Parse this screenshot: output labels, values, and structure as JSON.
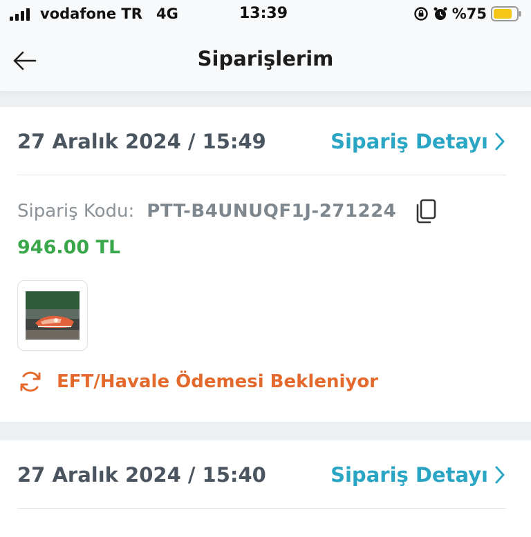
{
  "status_bar": {
    "carrier": "vodafone TR",
    "network": "4G",
    "time": "13:39",
    "battery": "%75",
    "battery_color": "#f5c518"
  },
  "header": {
    "title": "Siparişlerim",
    "back_icon": "arrow-left-icon"
  },
  "orders": [
    {
      "date": "27 Aralık 2024 / 15:49",
      "detail_label": "Sipariş Detayı",
      "code_label": "Sipariş Kodu:",
      "code_value": "PTT-B4UNUQF1J-271224",
      "price": "946.00 TL",
      "status": "EFT/Havale Ödemesi Bekleniyor",
      "status_icon": "refresh-icon"
    },
    {
      "date": "27 Aralık 2024 / 15:40",
      "detail_label": "Sipariş Detayı"
    }
  ],
  "colors": {
    "accent": "#2aa6c4",
    "price": "#3aa84a",
    "status": "#e36a2c"
  }
}
